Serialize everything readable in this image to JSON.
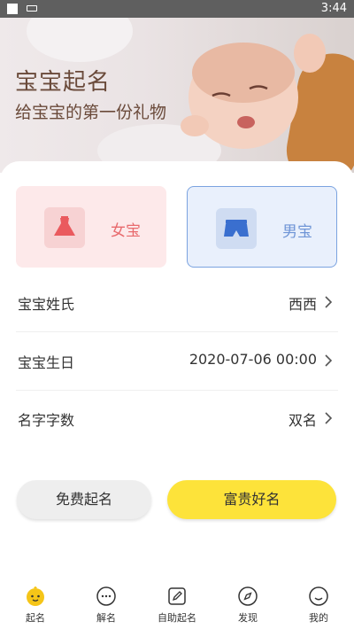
{
  "status_bar": {
    "time": "3:44"
  },
  "banner": {
    "title": "宝宝起名",
    "subtitle": "给宝宝的第一份礼物"
  },
  "gender": {
    "girl_label": "女宝",
    "boy_label": "男宝",
    "selected": "boy",
    "colors": {
      "girl": "#e86a6d",
      "boy": "#6f95d6"
    }
  },
  "form": [
    {
      "label": "宝宝姓氏",
      "value": "西西"
    },
    {
      "label": "宝宝生日",
      "value": "2020-07-06 00:00"
    },
    {
      "label": "名字字数",
      "value": "双名"
    }
  ],
  "actions": {
    "free_label": "免费起名",
    "premium_label": "富贵好名",
    "accent": "#fde33a"
  },
  "tabs": [
    {
      "label": "起名",
      "icon": "baby-face-icon",
      "active": true
    },
    {
      "label": "解名",
      "icon": "chat-bubble-icon"
    },
    {
      "label": "自助起名",
      "icon": "edit-icon"
    },
    {
      "label": "发现",
      "icon": "compass-icon"
    },
    {
      "label": "我的",
      "icon": "smile-icon"
    }
  ]
}
